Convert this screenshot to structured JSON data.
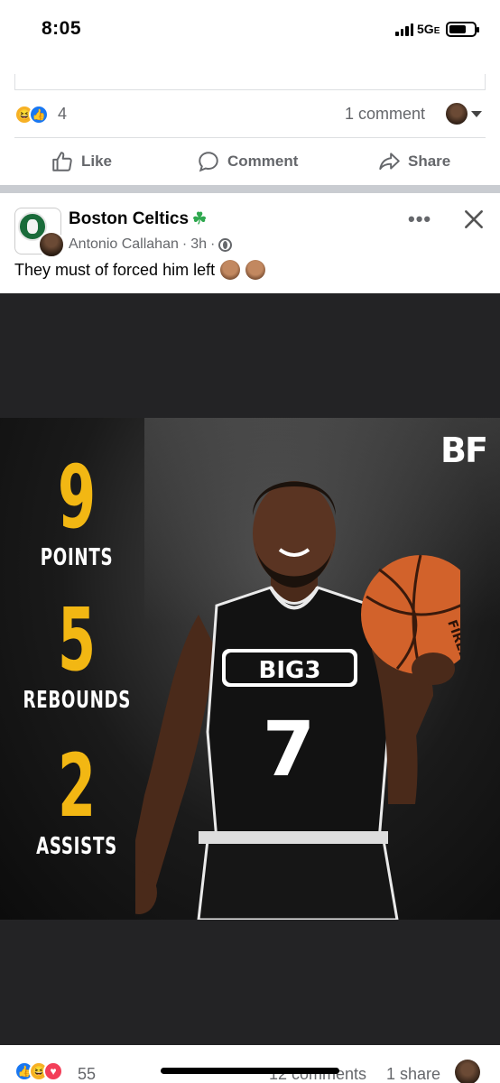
{
  "status_bar": {
    "time": "8:05",
    "network": "5G",
    "network_suffix": "E"
  },
  "previous_post": {
    "reaction_count": "4",
    "comments_label": "1 comment",
    "actions": {
      "like": "Like",
      "comment": "Comment",
      "share": "Share"
    }
  },
  "post": {
    "page_name": "Boston Celtics",
    "page_emoji": "☘",
    "author": "Antonio Callahan",
    "time": "3h",
    "caption": "They must of forced him left",
    "graphic": {
      "logo": "BF",
      "stats": [
        {
          "value": "9",
          "label": "POINTS"
        },
        {
          "value": "5",
          "label": "REBOUNDS"
        },
        {
          "value": "2",
          "label": "ASSISTS"
        }
      ],
      "jersey_text": "BIG3",
      "jersey_number": "7",
      "ball_text": "FIREBALL"
    },
    "reaction_count": "55",
    "comments_label": "12 comments",
    "shares_label": "1 share"
  },
  "colors": {
    "accent_yellow": "#f2b713",
    "fb_blue": "#1877f2",
    "muted": "#65676b"
  }
}
